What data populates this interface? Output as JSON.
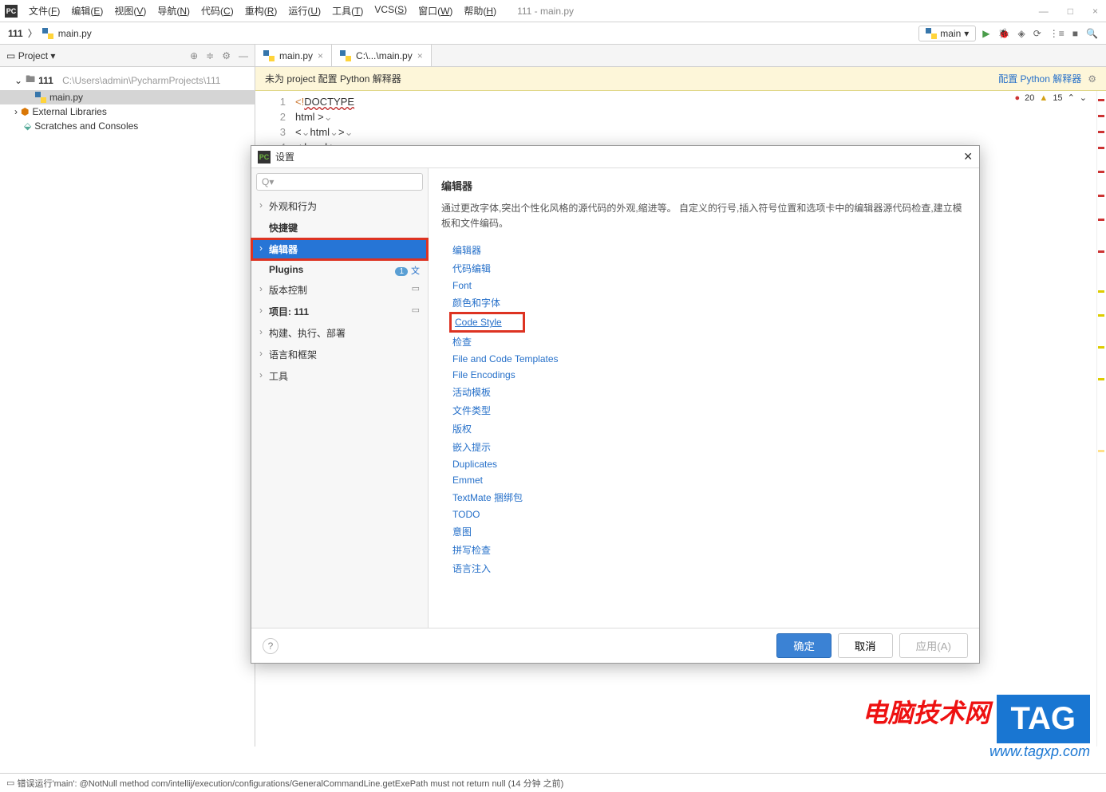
{
  "window": {
    "title": "111 - main.py",
    "controls": {
      "min": "—",
      "max": "□",
      "close": "×"
    }
  },
  "menu": [
    {
      "label": "文件",
      "key": "F"
    },
    {
      "label": "编辑",
      "key": "E"
    },
    {
      "label": "视图",
      "key": "V"
    },
    {
      "label": "导航",
      "key": "N"
    },
    {
      "label": "代码",
      "key": "C"
    },
    {
      "label": "重构",
      "key": "R"
    },
    {
      "label": "运行",
      "key": "U"
    },
    {
      "label": "工具",
      "key": "T"
    },
    {
      "label": "VCS",
      "key": "S"
    },
    {
      "label": "窗口",
      "key": "W"
    },
    {
      "label": "帮助",
      "key": "H"
    }
  ],
  "breadcrumb": {
    "project": "111",
    "file": "main.py"
  },
  "run_config": {
    "name": "main"
  },
  "project_panel": {
    "title": "Project",
    "root": "111",
    "root_path": "C:\\Users\\admin\\PycharmProjects\\111",
    "files": [
      "main.py"
    ],
    "external": "External Libraries",
    "scratches": "Scratches and Consoles"
  },
  "tabs": [
    {
      "label": "main.py"
    },
    {
      "label": "C:\\...\\main.py"
    }
  ],
  "warning": {
    "text": "未为 project 配置 Python 解释器",
    "link": "配置 Python 解释器"
  },
  "code_lines": [
    "1",
    "2",
    "3",
    "4"
  ],
  "inspection": {
    "errors": "20",
    "warnings": "15"
  },
  "dialog": {
    "title": "设置",
    "search_placeholder": "Q▾",
    "categories": [
      {
        "label": "外观和行为",
        "expandable": true
      },
      {
        "label": "快捷键",
        "expandable": false
      },
      {
        "label": "编辑器",
        "expandable": true,
        "selected": true,
        "highlighted": true
      },
      {
        "label": "Plugins",
        "expandable": false,
        "badge": "1",
        "trans": true
      },
      {
        "label": "版本控制",
        "expandable": true,
        "proj": true
      },
      {
        "label": "项目: 111",
        "expandable": true,
        "proj": true
      },
      {
        "label": "构建、执行、部署",
        "expandable": true
      },
      {
        "label": "语言和框架",
        "expandable": true
      },
      {
        "label": "工具",
        "expandable": true
      }
    ],
    "content": {
      "heading": "编辑器",
      "desc": "通过更改字体,突出个性化风格的源代码的外观,缩进等。 自定义的行号,插入符号位置和选项卡中的编辑器源代码检查,建立模板和文件编码。",
      "links": [
        "编辑器",
        "代码编辑",
        "Font",
        "颜色和字体",
        "Code Style",
        "检查",
        "File and Code Templates",
        "File Encodings",
        "活动模板",
        "文件类型",
        "版权",
        "嵌入提示",
        "Duplicates",
        "Emmet",
        "TextMate 捆绑包",
        "TODO",
        "意图",
        "拼写检查",
        "语言注入"
      ]
    },
    "buttons": {
      "ok": "确定",
      "cancel": "取消",
      "apply": "应用(A)"
    }
  },
  "status": "错误运行'main': @NotNull method com/intellij/execution/configurations/GeneralCommandLine.getExePath must not return null (14 分钟 之前)",
  "watermark": {
    "cn": "电脑技术网",
    "tag": "TAG",
    "url": "www.tagxp.com"
  }
}
